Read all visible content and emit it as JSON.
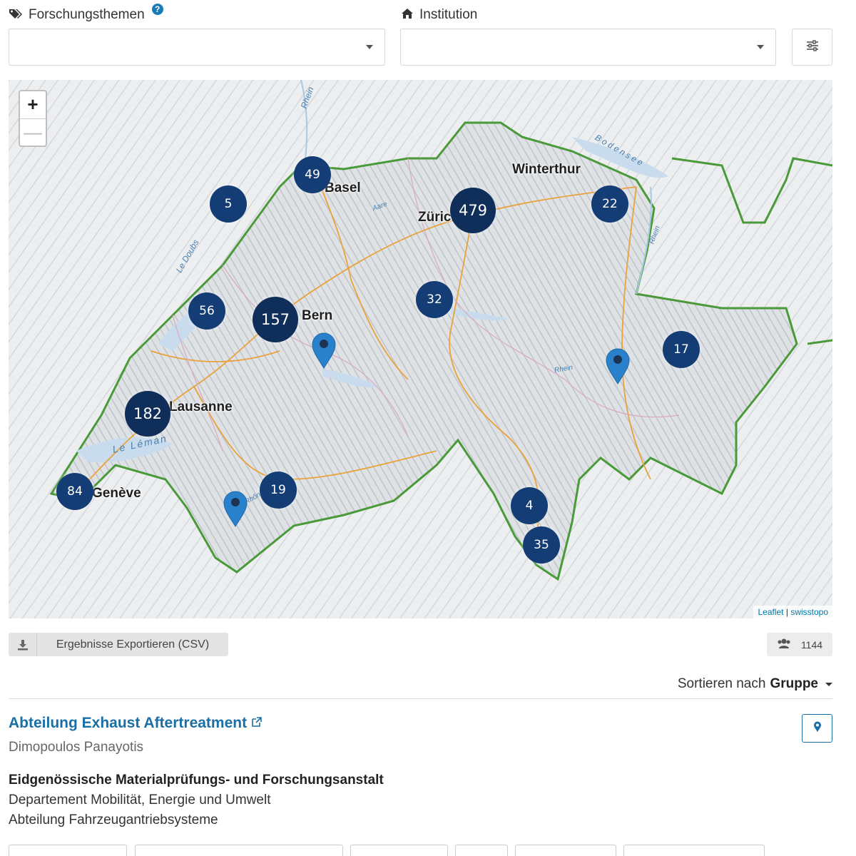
{
  "filters": {
    "topics_label": "Forschungsthemen",
    "topics_value": "",
    "institution_label": "Institution",
    "institution_value": ""
  },
  "map": {
    "zoom_in": "+",
    "zoom_out": "—",
    "cities": [
      "Basel",
      "Zürich",
      "Winterthur",
      "Bern",
      "Lausanne",
      "Genève"
    ],
    "waters": [
      "Rhein",
      "Bodensee",
      "Aare",
      "Le Doubs",
      "Le Léman",
      "Rhein",
      "Rhône",
      "Rhein"
    ],
    "clusters": [
      "5",
      "49",
      "479",
      "22",
      "56",
      "157",
      "32",
      "17",
      "182",
      "84",
      "19",
      "4",
      "35"
    ],
    "attribution_leaflet": "Leaflet",
    "attribution_sep": "|",
    "attribution_source": "swisstopo"
  },
  "toolbar": {
    "export_label": "Ergebnisse Exportieren (CSV)",
    "count": "1144"
  },
  "sort": {
    "prefix": "Sortieren nach",
    "value": "Gruppe"
  },
  "result": {
    "title": "Abteilung Exhaust Aftertreatment",
    "person": "Dimopoulos Panayotis",
    "institution": "Eidgenössische Materialprüfungs- und Forschungsanstalt",
    "department": "Departement Mobilität, Energie und Umwelt",
    "unit": "Abteilung Fahrzeugantriebsysteme"
  },
  "colors": {
    "accent": "#1a6fa6",
    "cluster_small": "#143d76",
    "cluster_large": "#0f2f5a",
    "marker": "#2a81cb",
    "border": "#4a9a3a"
  }
}
